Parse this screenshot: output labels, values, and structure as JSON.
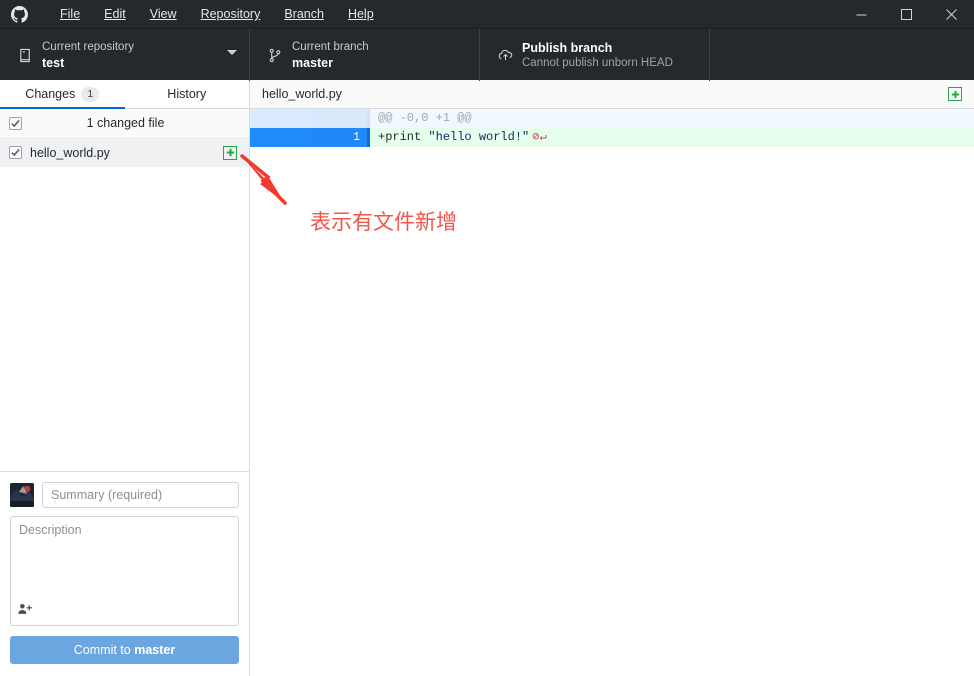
{
  "window": {
    "app_icon": "github-logo-icon",
    "menu": [
      {
        "label": "File",
        "accel": "F"
      },
      {
        "label": "Edit",
        "accel": "E"
      },
      {
        "label": "View",
        "accel": "V"
      },
      {
        "label": "Repository",
        "accel": "R"
      },
      {
        "label": "Branch",
        "accel": "B"
      },
      {
        "label": "Help",
        "accel": "H"
      }
    ],
    "controls": {
      "minimize": "minimize-icon",
      "maximize": "maximize-icon",
      "close": "close-icon"
    }
  },
  "toolbar": {
    "repository": {
      "icon": "repository-icon",
      "label": "Current repository",
      "value": "test",
      "dropdown": "chevron-down-icon"
    },
    "branch": {
      "icon": "branch-icon",
      "label": "Current branch",
      "value": "master"
    },
    "publish": {
      "icon": "cloud-upload-icon",
      "title": "Publish branch",
      "subtitle": "Cannot publish unborn HEAD"
    }
  },
  "sidebar": {
    "tabs": [
      {
        "label": "Changes",
        "badge": "1",
        "active": true
      },
      {
        "label": "History",
        "badge": "",
        "active": false
      }
    ],
    "all_files_row": {
      "checked": true,
      "label": "1 changed file"
    },
    "files": [
      {
        "name": "hello_world.py",
        "checked": true,
        "status_icon": "added-plus-icon",
        "status_color": "#28a745"
      }
    ],
    "commit": {
      "avatar": "user-avatar",
      "summary_placeholder": "Summary (required)",
      "summary_value": "",
      "description_placeholder": "Description",
      "description_value": "",
      "coauthor_icon": "add-coauthor-icon",
      "button_prefix": "Commit to ",
      "button_branch": "master"
    }
  },
  "diff": {
    "filename": "hello_world.py",
    "header_icon": "added-plus-icon",
    "lines": [
      {
        "type": "hunk",
        "old_no": "",
        "new_no": "",
        "text": "@@ -0,0 +1 @@"
      },
      {
        "type": "added",
        "old_no": "",
        "new_no": "1",
        "prefix": "+",
        "code_head": "print ",
        "code_string": "\"hello world!\"",
        "eol": "⊘↵"
      }
    ]
  },
  "annotation": {
    "text": "表示有文件新增",
    "color": "#f2554a",
    "arrow_icon": "red-arrow-icon"
  },
  "colors": {
    "chrome_dark": "#24292e",
    "accent_blue": "#0366d6",
    "added_green": "#28a745",
    "diff_added_bg": "#e6ffed",
    "diff_hunk_bg": "#f1f8ff",
    "gutter_selected": "#1f8cf9",
    "commit_button": "#6ca6e0"
  }
}
